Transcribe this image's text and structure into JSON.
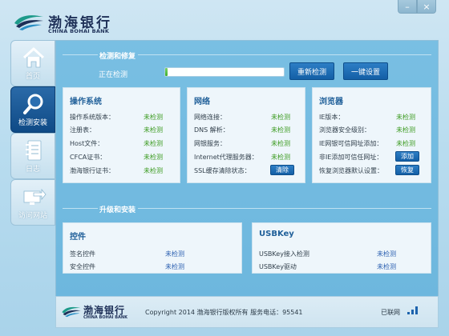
{
  "header": {
    "brand_cn": "渤海银行",
    "brand_en": "CHINA BOHAI BANK",
    "minimize": "–",
    "close": "×"
  },
  "sidebar": {
    "items": [
      {
        "label": "首页",
        "icon": "home-icon",
        "active": false
      },
      {
        "label": "检测安装",
        "icon": "magnifier-icon",
        "active": true
      },
      {
        "label": "日志",
        "icon": "notebook-icon",
        "active": false
      },
      {
        "label": "访问网站",
        "icon": "monitor-arrow-icon",
        "active": false
      }
    ]
  },
  "check": {
    "section_title": "检测和修复",
    "status_label": "正在检测",
    "progress_fraction": 0.02,
    "recheck_button": "重新检测",
    "oneclick_button": "一键设置"
  },
  "os_card": {
    "title": "操作系统",
    "rows": [
      {
        "label": "操作系统版本：",
        "value": "未检测"
      },
      {
        "label": "注册表：",
        "value": "未检测"
      },
      {
        "label": "Host文件：",
        "value": "未检测"
      },
      {
        "label": "CFCA证书：",
        "value": "未检测"
      },
      {
        "label": "渤海银行证书：",
        "value": "未检测"
      }
    ]
  },
  "net_card": {
    "title": "网络",
    "rows": [
      {
        "label": "网络连接：",
        "value": "未检测"
      },
      {
        "label": "DNS 解析：",
        "value": "未检测"
      },
      {
        "label": "网银服务：",
        "value": "未检测"
      },
      {
        "label": "Internet代理服务器：",
        "value": "未检测"
      },
      {
        "label": "SSL缓存清除状态：",
        "button": "清除"
      }
    ]
  },
  "browser_card": {
    "title": "浏览器",
    "rows": [
      {
        "label": "IE版本：",
        "value": "未检测"
      },
      {
        "label": "浏览器安全级别：",
        "value": "未检测"
      },
      {
        "label": "IE网银可信网址添加：",
        "value": "未检测"
      },
      {
        "label": "非IE添加可信任网址：",
        "button": "添加"
      },
      {
        "label": "恢复浏览器默认设置：",
        "button": "恢复"
      }
    ]
  },
  "upgrade": {
    "section_title": "升级和安装"
  },
  "control_card": {
    "title": "控件",
    "rows": [
      {
        "label": "签名控件",
        "value": "未检测"
      },
      {
        "label": "安全控件",
        "value": "未检测"
      }
    ]
  },
  "usbkey_card": {
    "title": "USBKey",
    "rows": [
      {
        "label": "USBKey接入检测",
        "value": "未检测"
      },
      {
        "label": "USBKey驱动",
        "value": "未检测"
      }
    ]
  },
  "footer": {
    "brand_cn": "渤海银行",
    "brand_en": "CHINA BOHAI BANK",
    "copyright": "Copyright 2014 渤海银行版权所有 服务电话：95541",
    "net_status": "已联网",
    "signal_icon": "signal-bars-icon"
  },
  "colors": {
    "accent": "#135fa6",
    "ok_green": "#3a9a1e",
    "pending_blue": "#2a5fb0"
  }
}
